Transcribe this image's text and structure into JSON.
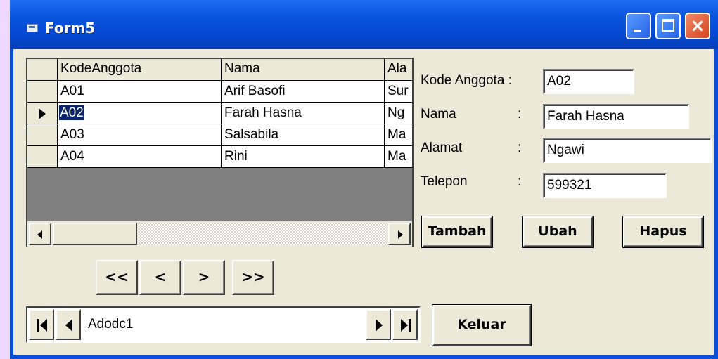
{
  "window": {
    "title": "Form5",
    "controls": {
      "minimize": "minimize-icon",
      "maximize": "maximize-icon",
      "close": "×"
    }
  },
  "grid": {
    "columns": [
      "KodeAnggota",
      "Nama",
      "Ala"
    ],
    "rows": [
      {
        "kode": "A01",
        "nama": "Arif Basofi",
        "alamat": "Sur"
      },
      {
        "kode": "A02",
        "nama": "Farah Hasna",
        "alamat": "Ng"
      },
      {
        "kode": "A03",
        "nama": "Salsabila",
        "alamat": "Ma"
      },
      {
        "kode": "A04",
        "nama": "Rini",
        "alamat": "Ma"
      }
    ],
    "current_row": 1
  },
  "nav": {
    "first": "<<",
    "prev": "<",
    "next": ">",
    "last": ">>"
  },
  "adodc": {
    "caption": "Adodc1"
  },
  "form": {
    "kode_label": "Kode Anggota  :",
    "kode_value": "A02",
    "nama_label": "Nama",
    "nama_colon": ":",
    "nama_value": "Farah Hasna",
    "alamat_label": "Alamat",
    "alamat_colon": ":",
    "alamat_value": "Ngawi",
    "telepon_label": "Telepon",
    "telepon_colon": ":",
    "telepon_value": "599321"
  },
  "buttons": {
    "tambah": "Tambah",
    "ubah": "Ubah",
    "hapus": "Hapus",
    "keluar": "Keluar"
  }
}
